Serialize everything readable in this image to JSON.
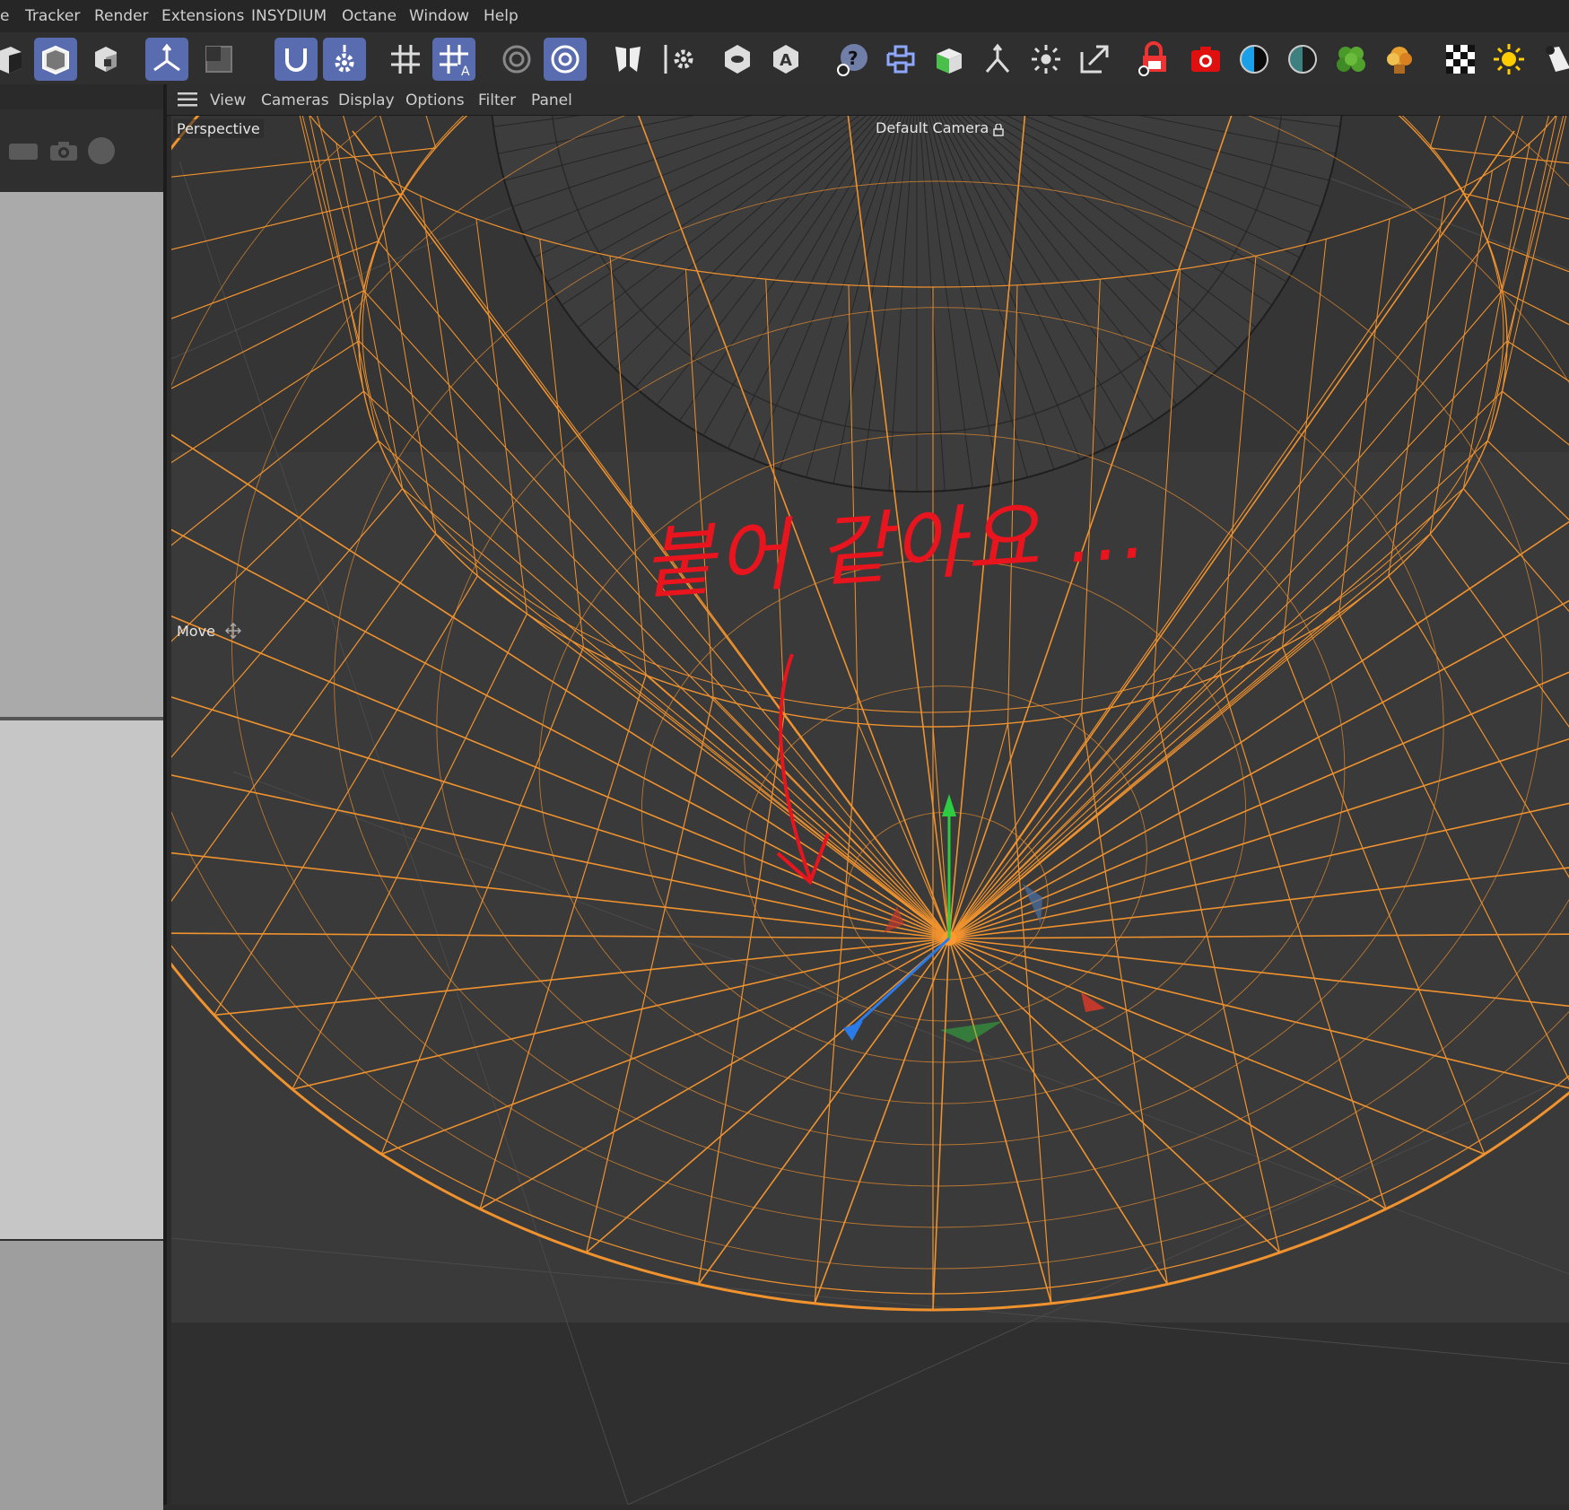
{
  "menubar": {
    "items": [
      "e",
      "Tracker",
      "Render",
      "Extensions",
      "INSYDIUM",
      "Octane",
      "Window",
      "Help"
    ]
  },
  "toolbar": {
    "icons": [
      "cube-partial-icon",
      "cube-model-icon",
      "cube-object-icon",
      "axis-icon",
      "frame-icon",
      "magnet-icon",
      "gear-snap-icon",
      "grid-snap-icon",
      "grid-snap-a-icon",
      "target-icon",
      "target-settings-icon",
      "symmetry-icon",
      "settings-icon",
      "hexagon-eye-icon",
      "hexagon-a-icon",
      "help-orb-icon",
      "python-icon",
      "green-cube-icon",
      "branch-icon",
      "focus-icon",
      "expand-icon",
      "lock-camera-icon",
      "camera-red-icon",
      "blue-circle-icon",
      "teal-circle-icon",
      "tree-icon",
      "explosion-icon",
      "checker-icon",
      "sun-icon",
      "spotlight-icon"
    ],
    "active_color": "#5a6cb0"
  },
  "viewport": {
    "menu": [
      "View",
      "Cameras",
      "Display",
      "Options",
      "Filter",
      "Panel"
    ],
    "projection_label": "Perspective",
    "camera_label": "Default Camera",
    "tool_label": "Move",
    "wire_color": "#f0922e",
    "annotation_text": "붙어 같아요 ...",
    "annotation_color": "#e8141e"
  }
}
